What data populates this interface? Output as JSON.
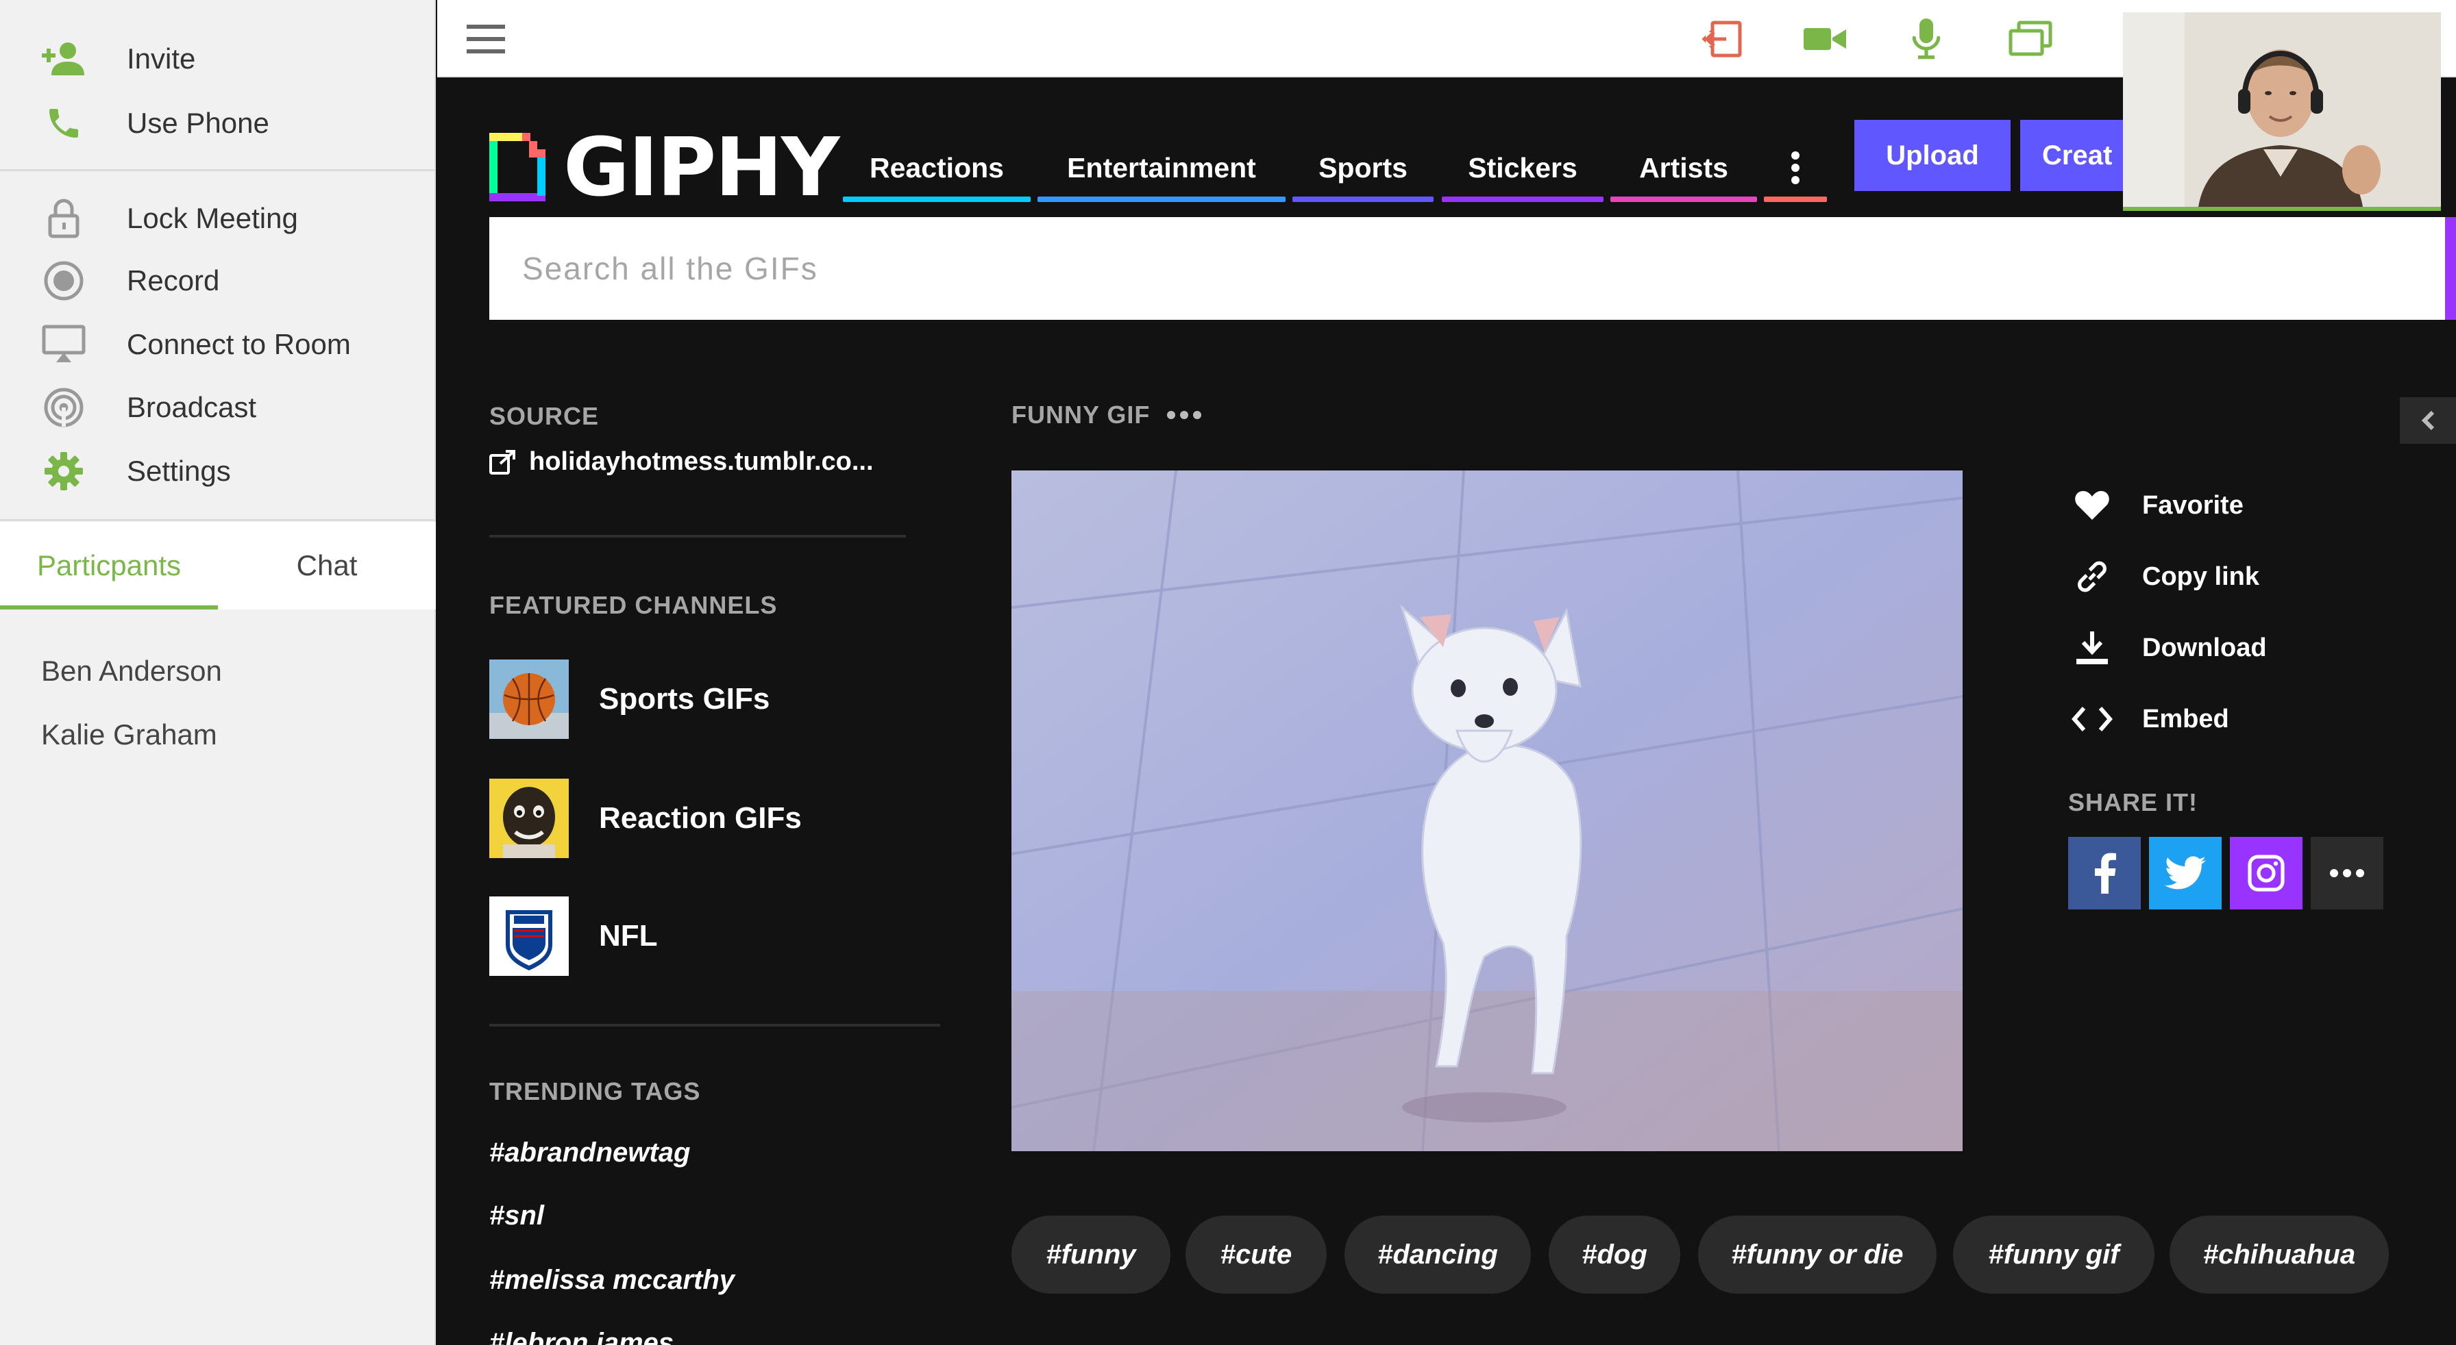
{
  "sidebar": {
    "menu": [
      {
        "label": "Invite",
        "icon": "add-person-icon"
      },
      {
        "label": "Use Phone",
        "icon": "phone-icon"
      },
      {
        "label": "Lock Meeting",
        "icon": "lock-icon"
      },
      {
        "label": "Record",
        "icon": "record-icon"
      },
      {
        "label": "Connect to Room",
        "icon": "monitor-icon"
      },
      {
        "label": "Broadcast",
        "icon": "broadcast-icon"
      },
      {
        "label": "Settings",
        "icon": "gear-icon"
      }
    ],
    "tabs": [
      {
        "label": "Particpants",
        "active": true
      },
      {
        "label": "Chat",
        "active": false
      }
    ],
    "participants": [
      "Ben Anderson",
      "Kalie Graham"
    ],
    "accent_color": "#7ab648"
  },
  "toolbar": {
    "icons": [
      "hamburger-menu-icon",
      "leave-icon",
      "video-camera-icon",
      "microphone-icon",
      "screen-share-icon"
    ]
  },
  "giphy": {
    "logo": "GIPHY",
    "nav": [
      {
        "label": "Reactions",
        "color": "#00ccff"
      },
      {
        "label": "Entertainment",
        "color": "#3399ff"
      },
      {
        "label": "Sports",
        "color": "#6157ff"
      },
      {
        "label": "Stickers",
        "color": "#9933ff"
      },
      {
        "label": "Artists",
        "color": "#e646b6"
      }
    ],
    "more_icon": "vertical-dots-icon",
    "upload_label": "Upload",
    "create_label": "Creat",
    "search_placeholder": "Search all the GIFs",
    "source_header": "SOURCE",
    "source_link": "holidayhotmess.tumblr.co...",
    "featured_header": "FEATURED CHANNELS",
    "channels": [
      "Sports GIFs",
      "Reaction GIFs",
      "NFL"
    ],
    "trending_header": "TRENDING TAGS",
    "trending": [
      "#abrandnewtag",
      "#snl",
      "#melissa mccarthy",
      "#lebron james"
    ],
    "gif_title": "FUNNY GIF",
    "actions": [
      {
        "label": "Favorite",
        "icon": "heart-icon"
      },
      {
        "label": "Copy link",
        "icon": "link-icon"
      },
      {
        "label": "Download",
        "icon": "download-icon"
      },
      {
        "label": "Embed",
        "icon": "code-brackets-icon"
      }
    ],
    "share_header": "SHARE IT!",
    "share": [
      {
        "name": "facebook",
        "icon": "facebook-icon",
        "color": "#3b5998"
      },
      {
        "name": "twitter",
        "icon": "twitter-icon",
        "color": "#1da1f2"
      },
      {
        "name": "instagram",
        "icon": "instagram-icon",
        "color": "#9933ff"
      },
      {
        "name": "more",
        "icon": "more-dots-icon",
        "color": "#2b2b2b"
      }
    ],
    "tags": [
      "#funny",
      "#cute",
      "#dancing",
      "#dog",
      "#funny or die",
      "#funny gif",
      "#chihuahua"
    ]
  }
}
